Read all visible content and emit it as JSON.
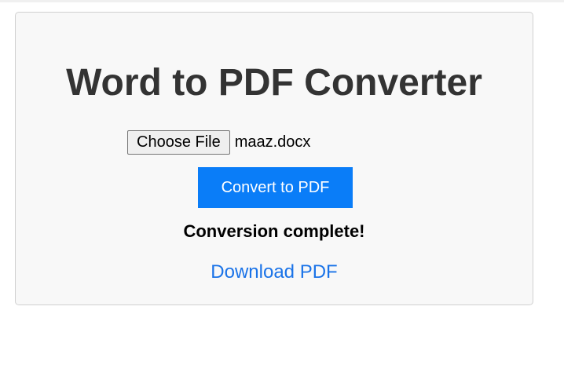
{
  "app": {
    "title": "Word to PDF Converter"
  },
  "file_input": {
    "button_label": "Choose File",
    "selected_file": "maaz.docx"
  },
  "actions": {
    "convert_label": "Convert to PDF"
  },
  "status": {
    "message": "Conversion complete!"
  },
  "download": {
    "link_label": "Download PDF"
  },
  "colors": {
    "accent": "#0a7df8",
    "link": "#1a73e8",
    "title": "#333333",
    "card_background": "#f8f8f8"
  }
}
